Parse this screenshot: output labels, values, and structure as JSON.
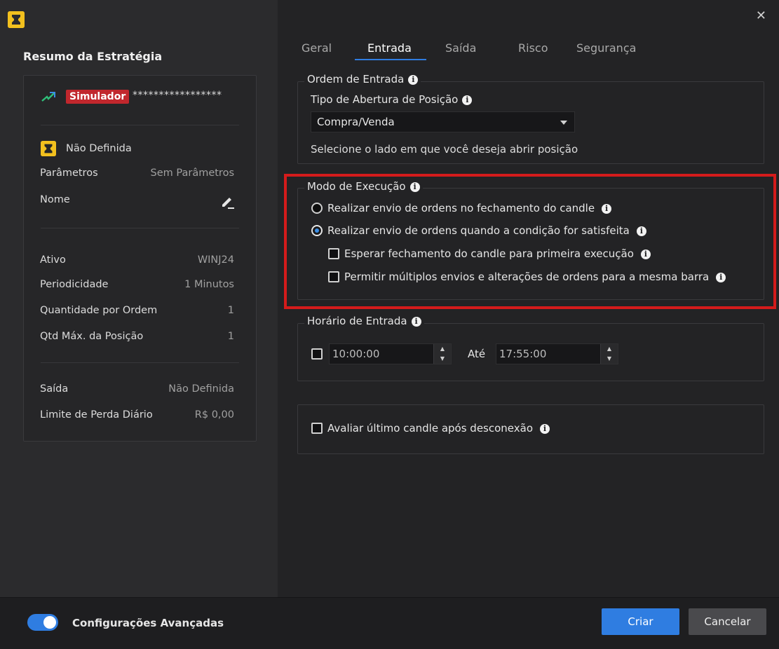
{
  "window": {
    "close_glyph": "✕"
  },
  "summary": {
    "title": "Resumo da Estratégia",
    "badge": "Simulador",
    "account_masked": "*****************",
    "strategy_name": "Não Definida",
    "parametros_label": "Parâmetros",
    "parametros_value": "Sem Parâmetros",
    "nome_label": "Nome",
    "ativo_label": "Ativo",
    "ativo_value": "WINJ24",
    "periodicidade_label": "Periodicidade",
    "periodicidade_value": "1 Minutos",
    "qtd_ordem_label": "Quantidade por Ordem",
    "qtd_ordem_value": "1",
    "qtd_max_label": "Qtd Máx. da Posição",
    "qtd_max_value": "1",
    "saida_label": "Saída",
    "saida_value": "Não Definida",
    "limite_label": "Limite de Perda Diário",
    "limite_value": "R$ 0,00"
  },
  "tabs": [
    {
      "label": "Geral",
      "active": false
    },
    {
      "label": "Entrada",
      "active": true
    },
    {
      "label": "Saída",
      "active": false
    },
    {
      "label": "Risco",
      "active": false
    },
    {
      "label": "Segurança",
      "active": false
    }
  ],
  "ordem_entrada": {
    "legend": "Ordem de Entrada",
    "tipo_label": "Tipo de Abertura de Posição",
    "tipo_value": "Compra/Venda",
    "hint": "Selecione o lado em que você deseja abrir posição"
  },
  "modo_execucao": {
    "legend": "Modo de Execução",
    "option_close": "Realizar envio de ordens no fechamento do candle",
    "option_condition": "Realizar envio de ordens quando a condição for satisfeita",
    "selected": "option_condition",
    "check_wait": "Esperar fechamento do candle para primeira execução",
    "check_multi": "Permitir múltiplos envios e alterações de ordens para a mesma barra"
  },
  "horario": {
    "legend": "Horário de Entrada",
    "start": "10:00:00",
    "ate_label": "Até",
    "end": "17:55:00"
  },
  "avaliar": {
    "label": "Avaliar último candle após desconexão"
  },
  "footer": {
    "advanced_label": "Configurações Avançadas",
    "advanced_on": true,
    "create_label": "Criar",
    "cancel_label": "Cancelar"
  },
  "colors": {
    "accent": "#2f7de1",
    "badge": "#c1272d",
    "highlight": "#d41b1b",
    "logo": "#f2c01e"
  }
}
